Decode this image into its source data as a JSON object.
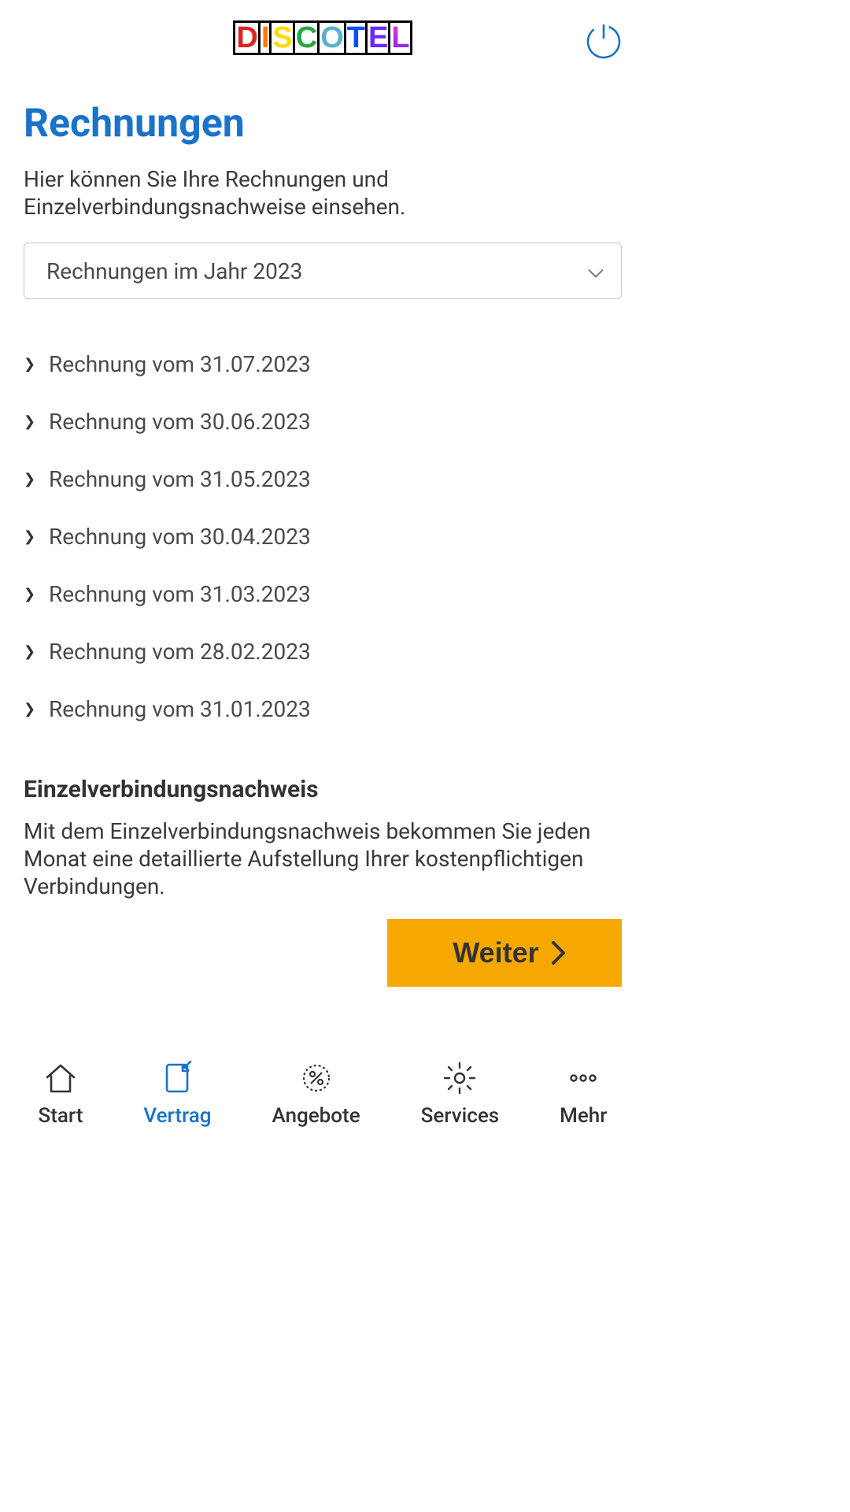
{
  "brand": {
    "name": "DISCOTEL"
  },
  "header": {
    "power_icon": "power-icon"
  },
  "page": {
    "title": "Rechnungen",
    "subtitle": "Hier können Sie Ihre Rechnungen und Einzelverbindungsnachweise einsehen."
  },
  "year_select": {
    "label": "Rechnungen im Jahr 2023"
  },
  "invoice_prefix": "Rechnung vom ",
  "invoices": [
    {
      "date": "31.07.2023"
    },
    {
      "date": "30.06.2023"
    },
    {
      "date": "31.05.2023"
    },
    {
      "date": "30.04.2023"
    },
    {
      "date": "31.03.2023"
    },
    {
      "date": "28.02.2023"
    },
    {
      "date": "31.01.2023"
    }
  ],
  "evn": {
    "heading": "Einzelverbindungsnachweis",
    "body": "Mit dem Einzelverbindungsnachweis bekommen Sie jeden Monat eine detaillierte Aufstellung Ihrer kostenpflichtigen Verbindungen.",
    "cta": "Weiter"
  },
  "tabs": [
    {
      "id": "start",
      "label": "Start",
      "icon": "home-icon",
      "active": false
    },
    {
      "id": "vertrag",
      "label": "Vertrag",
      "icon": "contract-icon",
      "active": true
    },
    {
      "id": "angebote",
      "label": "Angebote",
      "icon": "percent-icon",
      "active": false
    },
    {
      "id": "services",
      "label": "Services",
      "icon": "gear-icon",
      "active": false
    },
    {
      "id": "mehr",
      "label": "Mehr",
      "icon": "more-icon",
      "active": false
    }
  ],
  "colors": {
    "accent": "#1a73c9",
    "cta": "#f6a800"
  }
}
